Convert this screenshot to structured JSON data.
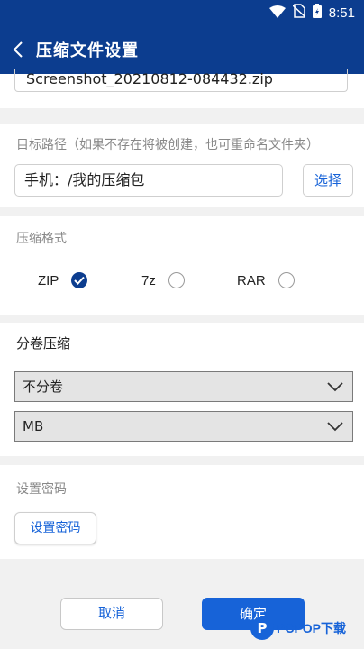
{
  "status_bar": {
    "time": "8:51",
    "icons": [
      "wifi-icon",
      "no-sim-icon",
      "battery-icon"
    ]
  },
  "app_bar": {
    "title": "压缩文件设置",
    "back_icon": "chevron-left-icon"
  },
  "filename": {
    "value": "Screenshot_20210812-084432.zip"
  },
  "target_path": {
    "label": "目标路径（如果不存在将被创建，也可重命名文件夹）",
    "value": "手机：/我的压缩包",
    "select_button": "选择"
  },
  "compress_format": {
    "label": "压缩格式",
    "options": [
      {
        "label": "ZIP",
        "checked": true
      },
      {
        "label": "7z",
        "checked": false
      },
      {
        "label": "RAR",
        "checked": false
      }
    ]
  },
  "split_volume": {
    "label": "分卷压缩",
    "mode_value": "不分卷",
    "unit_value": "MB"
  },
  "password": {
    "label": "设置密码",
    "button": "设置密码"
  },
  "actions": {
    "cancel": "取消",
    "confirm": "确定"
  },
  "watermark": {
    "logo": "P",
    "text": "PCPOP下载"
  },
  "colors": {
    "primary": "#0c3d8f",
    "accent": "#1763d8",
    "background": "#f1f1f1"
  }
}
